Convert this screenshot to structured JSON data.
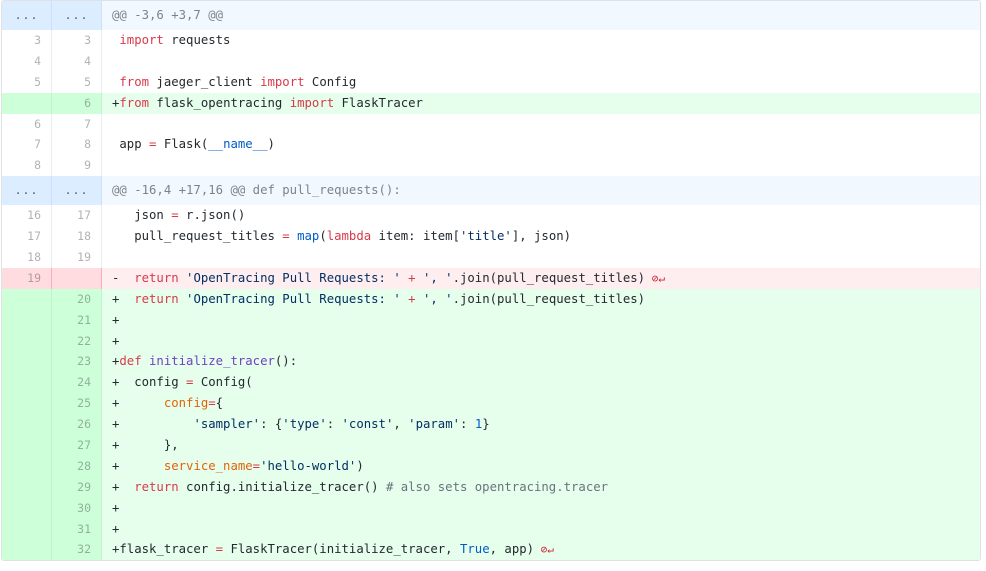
{
  "hunks": [
    {
      "header": "@@ -3,6 +3,7 @@",
      "expand_label": "...",
      "lines": [
        {
          "type": "ctx",
          "old": "3",
          "new": "3",
          "tokens": [
            [
              " ",
              ""
            ],
            [
              "import",
              "kw"
            ],
            [
              " requests",
              ""
            ]
          ]
        },
        {
          "type": "ctx",
          "old": "4",
          "new": "4",
          "tokens": []
        },
        {
          "type": "ctx",
          "old": "5",
          "new": "5",
          "tokens": [
            [
              " ",
              ""
            ],
            [
              "from",
              "kw"
            ],
            [
              " jaeger_client ",
              ""
            ],
            [
              "import",
              "kw"
            ],
            [
              " Config",
              ""
            ]
          ]
        },
        {
          "type": "add",
          "old": "",
          "new": "6",
          "tokens": [
            [
              "+",
              ""
            ],
            [
              "from",
              "kw"
            ],
            [
              " flask_opentracing ",
              ""
            ],
            [
              "import",
              "kw"
            ],
            [
              " FlaskTracer",
              ""
            ]
          ]
        },
        {
          "type": "ctx",
          "old": "6",
          "new": "7",
          "tokens": []
        },
        {
          "type": "ctx",
          "old": "7",
          "new": "8",
          "tokens": [
            [
              " app ",
              ""
            ],
            [
              "=",
              "kw"
            ],
            [
              " Flask(",
              ""
            ],
            [
              "__name__",
              "cst"
            ],
            [
              ")",
              ""
            ]
          ]
        },
        {
          "type": "ctx",
          "old": "8",
          "new": "9",
          "tokens": []
        }
      ]
    },
    {
      "header": "@@ -16,4 +17,16 @@ def pull_requests():",
      "expand_label": "...",
      "lines": [
        {
          "type": "ctx",
          "old": "16",
          "new": "17",
          "tokens": [
            [
              "   json ",
              ""
            ],
            [
              "=",
              "kw"
            ],
            [
              " r.json()",
              ""
            ]
          ]
        },
        {
          "type": "ctx",
          "old": "17",
          "new": "18",
          "tokens": [
            [
              "   pull_request_titles ",
              ""
            ],
            [
              "=",
              "kw"
            ],
            [
              " ",
              ""
            ],
            [
              "map",
              "cst"
            ],
            [
              "(",
              ""
            ],
            [
              "lambda",
              "kw"
            ],
            [
              " item: item[",
              ""
            ],
            [
              "'title'",
              "str"
            ],
            [
              "], json)",
              ""
            ]
          ]
        },
        {
          "type": "ctx",
          "old": "18",
          "new": "19",
          "tokens": []
        },
        {
          "type": "del",
          "old": "19",
          "new": "",
          "tokens": [
            [
              "-  ",
              ""
            ],
            [
              "return",
              "kw"
            ],
            [
              " ",
              ""
            ],
            [
              "'OpenTracing Pull Requests: '",
              "str"
            ],
            [
              " ",
              ""
            ],
            [
              "+",
              "kw"
            ],
            [
              " ",
              ""
            ],
            [
              "', '",
              "str"
            ],
            [
              ".join(pull_request_titles)",
              ""
            ],
            [
              " ⊘↵",
              "nonl"
            ]
          ]
        },
        {
          "type": "add",
          "old": "",
          "new": "20",
          "tokens": [
            [
              "+  ",
              ""
            ],
            [
              "return",
              "kw"
            ],
            [
              " ",
              ""
            ],
            [
              "'OpenTracing Pull Requests: '",
              "str"
            ],
            [
              " ",
              ""
            ],
            [
              "+",
              "kw"
            ],
            [
              " ",
              ""
            ],
            [
              "', '",
              "str"
            ],
            [
              ".join(pull_request_titles)",
              ""
            ]
          ]
        },
        {
          "type": "add",
          "old": "",
          "new": "21",
          "tokens": [
            [
              "+",
              ""
            ]
          ]
        },
        {
          "type": "add",
          "old": "",
          "new": "22",
          "tokens": [
            [
              "+",
              ""
            ]
          ]
        },
        {
          "type": "add",
          "old": "",
          "new": "23",
          "tokens": [
            [
              "+",
              ""
            ],
            [
              "def",
              "kw"
            ],
            [
              " ",
              ""
            ],
            [
              "initialize_tracer",
              "fn"
            ],
            [
              "():",
              ""
            ]
          ]
        },
        {
          "type": "add",
          "old": "",
          "new": "24",
          "tokens": [
            [
              "+  config ",
              ""
            ],
            [
              "=",
              "kw"
            ],
            [
              " Config(",
              ""
            ]
          ]
        },
        {
          "type": "add",
          "old": "",
          "new": "25",
          "tokens": [
            [
              "+      ",
              ""
            ],
            [
              "config",
              "var"
            ],
            [
              "=",
              "kw"
            ],
            [
              "{",
              ""
            ]
          ]
        },
        {
          "type": "add",
          "old": "",
          "new": "26",
          "tokens": [
            [
              "+          ",
              ""
            ],
            [
              "'sampler'",
              "str"
            ],
            [
              ": {",
              ""
            ],
            [
              "'type'",
              "str"
            ],
            [
              ": ",
              ""
            ],
            [
              "'const'",
              "str"
            ],
            [
              ", ",
              ""
            ],
            [
              "'param'",
              "str"
            ],
            [
              ": ",
              ""
            ],
            [
              "1",
              "cst"
            ],
            [
              "}",
              ""
            ]
          ]
        },
        {
          "type": "add",
          "old": "",
          "new": "27",
          "tokens": [
            [
              "+      },",
              ""
            ]
          ]
        },
        {
          "type": "add",
          "old": "",
          "new": "28",
          "tokens": [
            [
              "+      ",
              ""
            ],
            [
              "service_name",
              "var"
            ],
            [
              "=",
              "kw"
            ],
            [
              "'hello-world'",
              "str"
            ],
            [
              ")",
              ""
            ]
          ]
        },
        {
          "type": "add",
          "old": "",
          "new": "29",
          "tokens": [
            [
              "+  ",
              ""
            ],
            [
              "return",
              "kw"
            ],
            [
              " config.initialize_tracer() ",
              ""
            ],
            [
              "# also sets opentracing.tracer",
              "cmt"
            ]
          ]
        },
        {
          "type": "add",
          "old": "",
          "new": "30",
          "tokens": [
            [
              "+",
              ""
            ]
          ]
        },
        {
          "type": "add",
          "old": "",
          "new": "31",
          "tokens": [
            [
              "+",
              ""
            ]
          ]
        },
        {
          "type": "add",
          "old": "",
          "new": "32",
          "tokens": [
            [
              "+flask_tracer ",
              ""
            ],
            [
              "=",
              "kw"
            ],
            [
              " FlaskTracer(initialize_tracer, ",
              ""
            ],
            [
              "True",
              "cst"
            ],
            [
              ", app)",
              ""
            ],
            [
              " ⊘↵",
              "nonl"
            ]
          ]
        }
      ]
    }
  ]
}
